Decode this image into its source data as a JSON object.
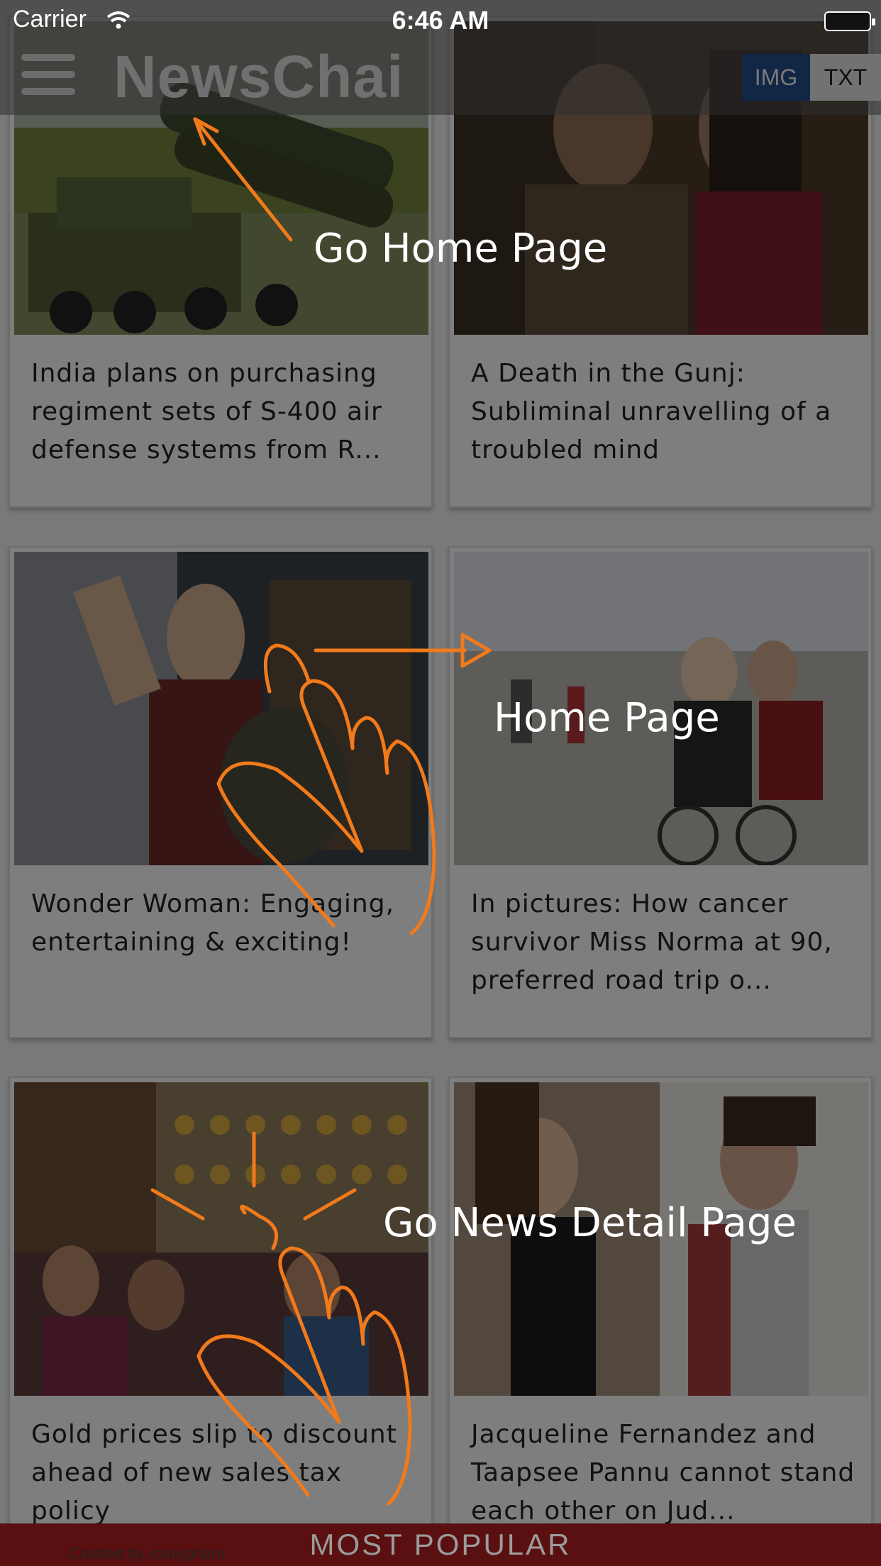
{
  "status_bar": {
    "carrier": "Carrier",
    "time": "6:46 AM"
  },
  "navbar": {
    "logo_text": "NewsChai",
    "toggle": {
      "img_label": "IMG",
      "txt_label": "TXT",
      "selected": "IMG"
    }
  },
  "cards": [
    {
      "title": "India plans on purchasing regiment sets of S-400 air defense systems from R..."
    },
    {
      "title": "A Death in the Gunj: Subliminal unravelling of a troubled mind"
    },
    {
      "title": "Wonder Woman: Engaging, entertaining & exciting!"
    },
    {
      "title": "In pictures: How cancer survivor Miss Norma at 90, preferred road trip o..."
    },
    {
      "title": "Gold prices slip to discount ahead of new sales tax policy"
    },
    {
      "title": "Jacqueline Fernandez and Taapsee Pannu cannot stand each other on Jud..."
    }
  ],
  "tutorial": {
    "go_home_label": "Go Home Page",
    "home_label": "Home Page",
    "go_detail_label": "Go News Detail Page"
  },
  "footer": {
    "label": "MOST POPULAR",
    "credit": "Created by iconsphere"
  },
  "colors": {
    "accent": "#f27a1a",
    "toggle_active": "#244a86",
    "footer": "#5a1010"
  }
}
